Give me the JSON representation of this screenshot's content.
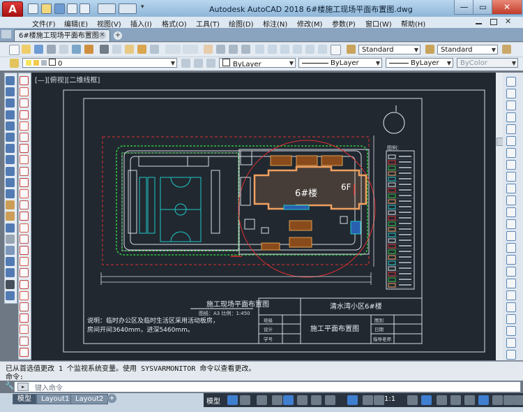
{
  "app": {
    "logo_letter": "A",
    "title": "Autodesk AutoCAD 2018       6#楼施工现场平面布置图.dwg",
    "window_controls": {
      "minimize": "—",
      "maximize": "▭",
      "close": "✕"
    }
  },
  "menu": {
    "items": [
      "文件(F)",
      "编辑(E)",
      "视图(V)",
      "插入(I)",
      "格式(O)",
      "工具(T)",
      "绘图(D)",
      "标注(N)",
      "修改(M)",
      "参数(P)",
      "窗口(W)",
      "帮助(H)"
    ]
  },
  "tabs": {
    "active": "6#楼施工现场平面布置图*",
    "close": "×",
    "new": "+"
  },
  "toolbar": {
    "text_style": "Standard",
    "dim_style": "Standard",
    "layer": "0",
    "color": "ByLayer",
    "linetype": "ByLayer",
    "lineweight": "ByLayer",
    "plotstyle": "ByColor"
  },
  "viewport": {
    "label": "[—][俯视][二维线框]"
  },
  "drawing": {
    "plan_title": "施工现场平面布置图",
    "plan_scale": "图纸：A3   比例：1:450",
    "note_line1": "说明：临时办公区及临时生活区采用活动板房，",
    "note_line2": "房间开间3640mm，进深5460mm。",
    "building_label": "6#楼",
    "floor_label": "6F",
    "legend_title": "图例：",
    "titleblock": {
      "project": "清水湾小区6#楼",
      "drawing_name": "施工平面布置图",
      "left_labels": [
        "班级",
        "设计",
        "学号"
      ],
      "right_labels": [
        "图别",
        "日期",
        "指导老师"
      ]
    }
  },
  "command": {
    "history_line1": "已从首选值更改 1 个监视系统变量。使用 SYSVARMONITOR 命令以查看更改。",
    "history_line2": "命令:",
    "placeholder": "键入命令"
  },
  "statusbar": {
    "layout_tabs": [
      "模型",
      "Layout1",
      "Layout2"
    ],
    "model_button": "模型",
    "scale": "1:1"
  },
  "colors": {
    "canvas": "#212830",
    "building": "#f0a060",
    "site_boundary": "#e03030",
    "fence": "#30c040",
    "court": "#20c8c8"
  }
}
